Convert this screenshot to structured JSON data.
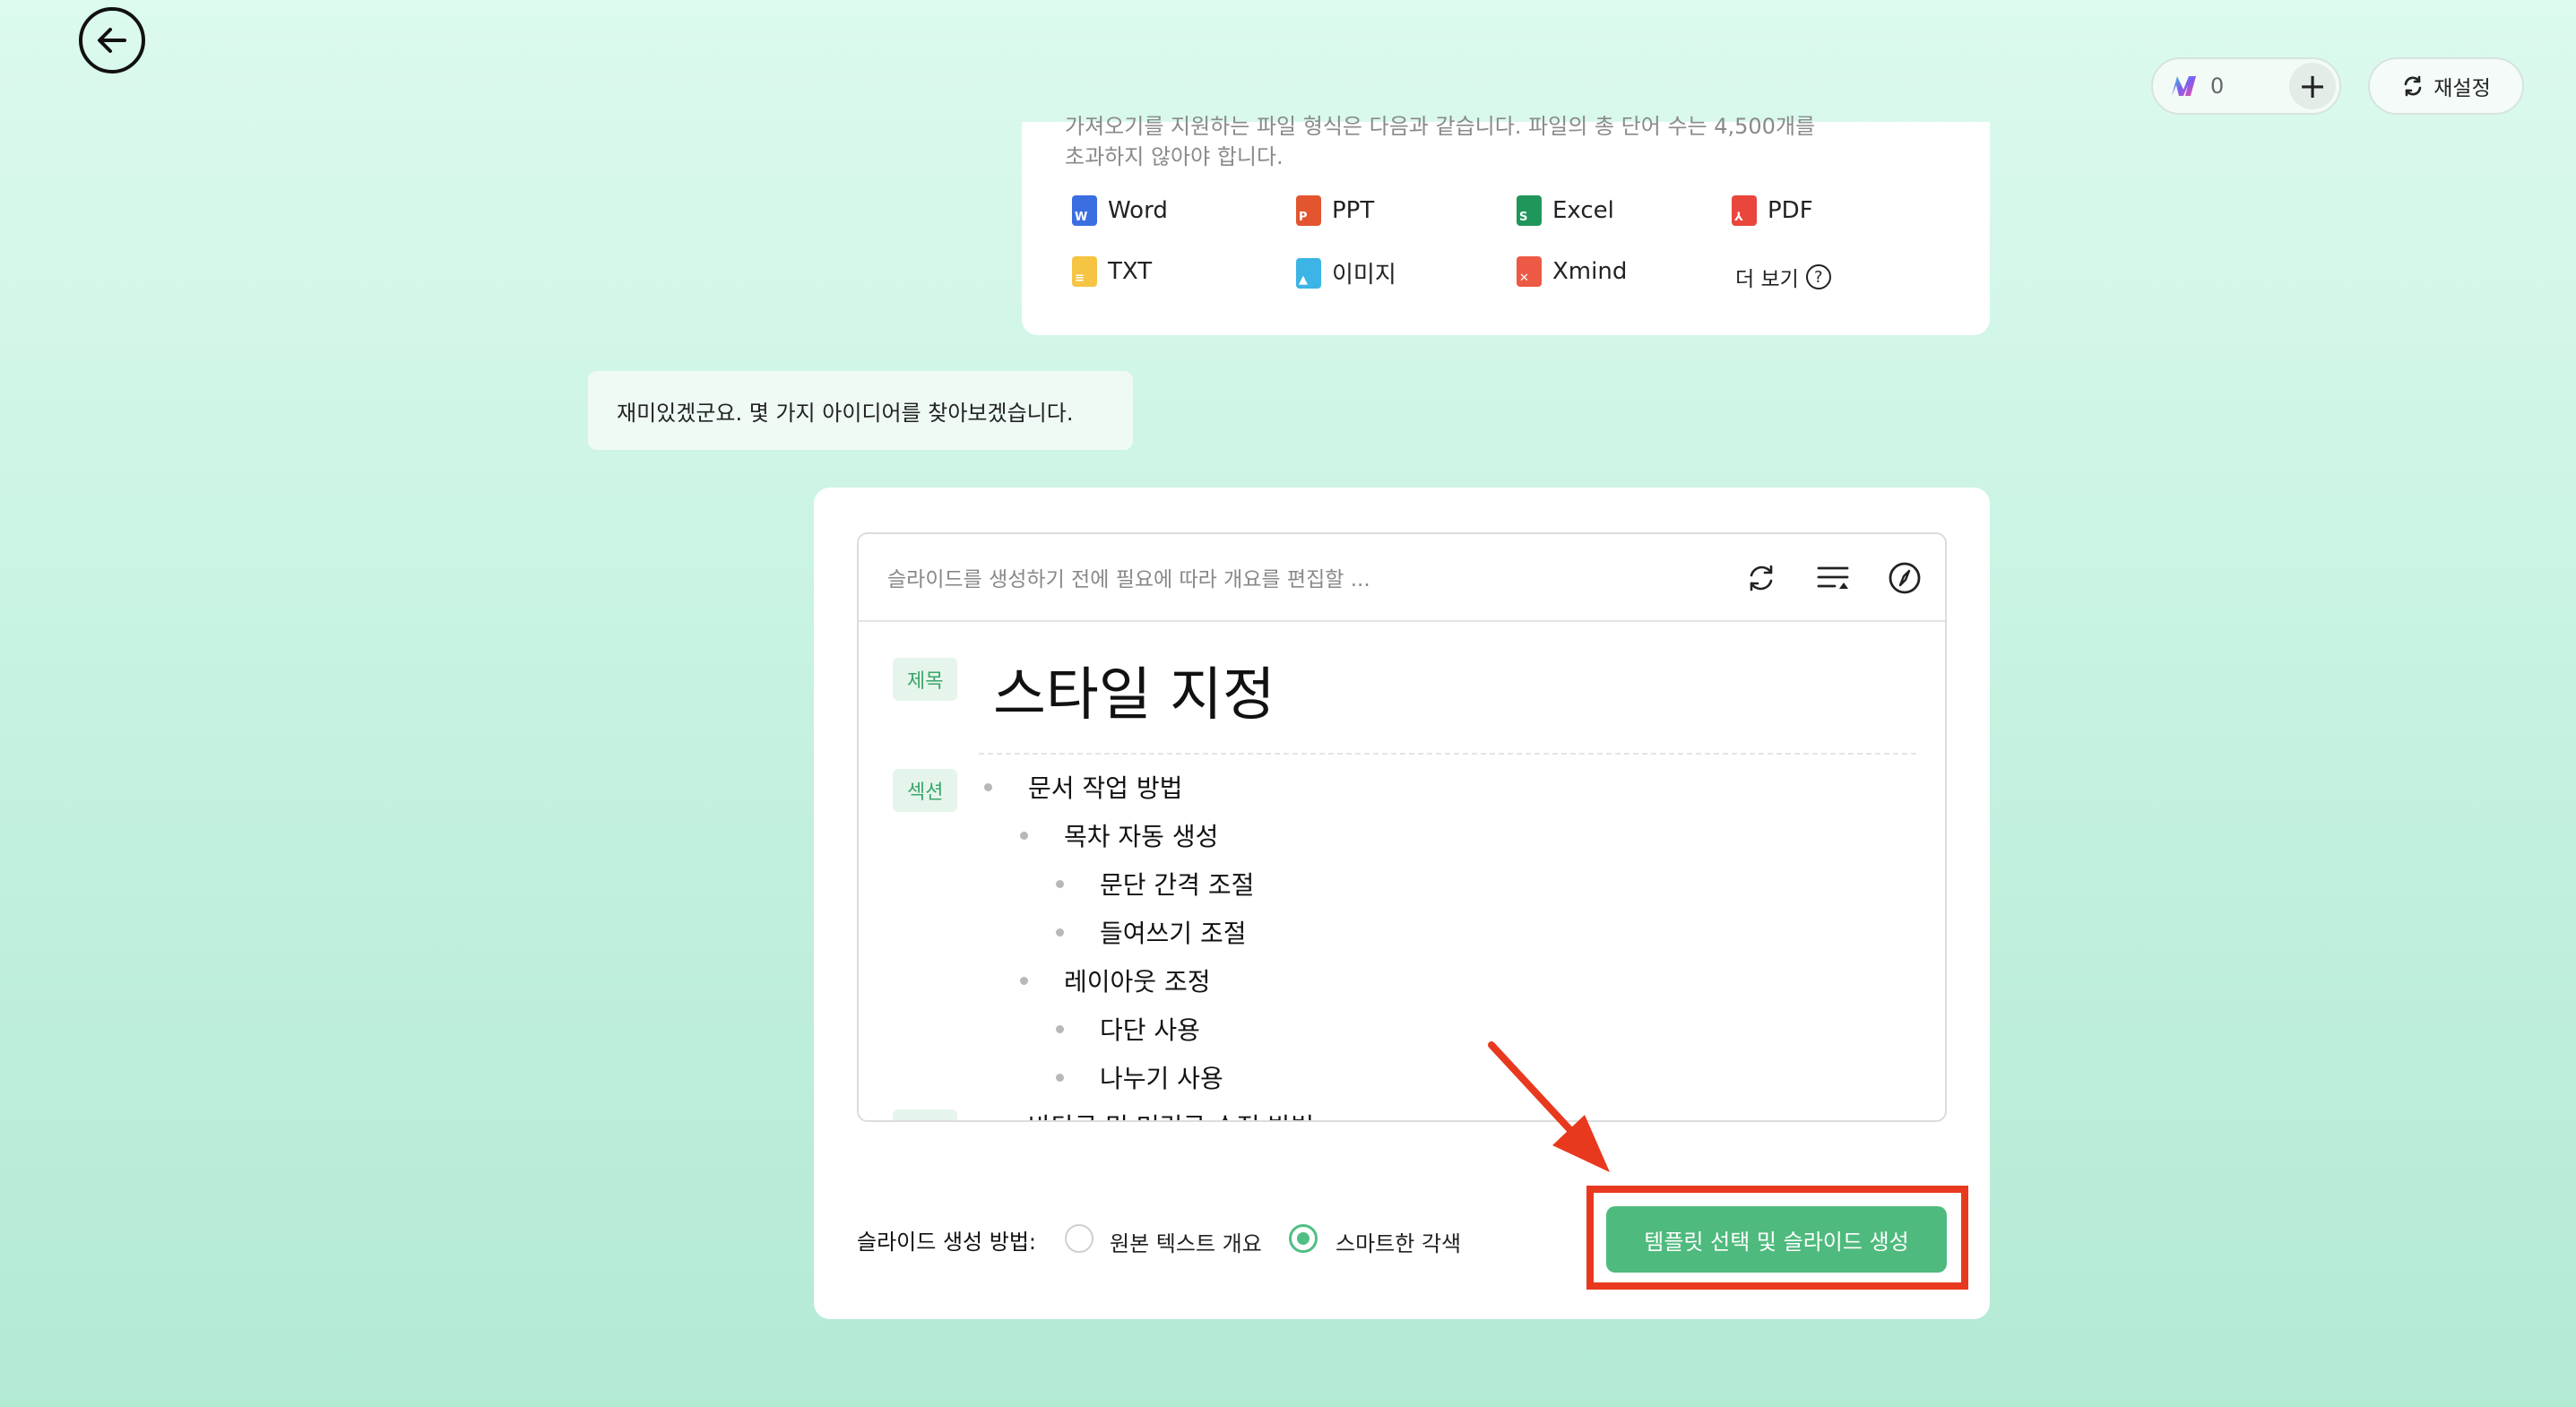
{
  "header": {
    "credits_value": "0",
    "plus_label": "+",
    "reset_label": "재설정"
  },
  "files": {
    "description_line1": "가져오기를 지원하는 파일 형식은 다음과 같습니다. 파일의 총 단어 수는 4,500개를",
    "description_line2": "초과하지 않아야 합니다.",
    "items": [
      {
        "label": "Word",
        "color": "#3b6ee0",
        "glyph": "W"
      },
      {
        "label": "PPT",
        "color": "#e2552f",
        "glyph": "P"
      },
      {
        "label": "Excel",
        "color": "#21965c",
        "glyph": "S"
      },
      {
        "label": "PDF",
        "color": "#e9463d",
        "glyph": "⅄"
      },
      {
        "label": "TXT",
        "color": "#f5c443",
        "glyph": "≡"
      },
      {
        "label": "이미지",
        "color": "#3cb4e6",
        "glyph": "▲"
      },
      {
        "label": "Xmind",
        "color": "#ec5a45",
        "glyph": "✕"
      }
    ],
    "more_label": "더 보기",
    "more_icon": "?"
  },
  "chat": {
    "message": "재미있겠군요. 몇 가지 아이디어를 찾아보겠습니다."
  },
  "outline": {
    "placeholder": "슬라이드를 생성하기 전에 필요에 따라 개요를 편집할 ...",
    "title_tag": "제목",
    "title": "스타일 지정",
    "section_tag": "섹션",
    "items": [
      {
        "level": 0,
        "text": "문서 작업 방법",
        "section": true
      },
      {
        "level": 1,
        "text": "목차 자동 생성"
      },
      {
        "level": 2,
        "text": "문단 간격 조절"
      },
      {
        "level": 2,
        "text": "들여쓰기 조절"
      },
      {
        "level": 1,
        "text": "레이아웃 조정"
      },
      {
        "level": 2,
        "text": "다단 사용"
      },
      {
        "level": 2,
        "text": "나누기 사용"
      },
      {
        "level": 0,
        "text": "바닥글 및 머릿글 수정 방법",
        "section": true
      }
    ]
  },
  "generation": {
    "method_label": "슬라이드 생성 방법:",
    "option_original": "원본 텍스트 개요",
    "option_smart": "스마트한 각색",
    "selected": "스마트한 각색",
    "button_label": "템플릿 선택 및 슬라이드 생성"
  },
  "colors": {
    "accent_green": "#4fba7d",
    "annotation_red": "#e8391f"
  }
}
